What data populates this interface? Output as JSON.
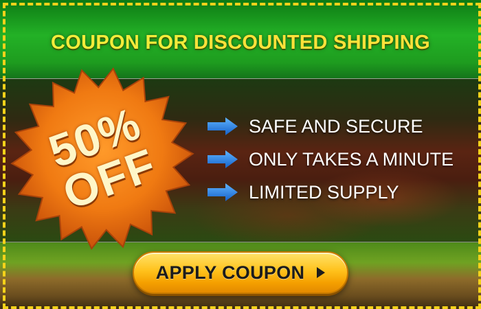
{
  "title": {
    "part1": "COUPON FOR ",
    "part2": "DISCOUNTED SHIPPING"
  },
  "badge": {
    "percent": "50%",
    "off": "OFF"
  },
  "features": [
    {
      "label": "SAFE AND SECURE",
      "icon": "arrow-right-icon"
    },
    {
      "label": "ONLY TAKES A MINUTE",
      "icon": "arrow-right-icon"
    },
    {
      "label": "LIMITED SUPPLY",
      "icon": "arrow-right-icon"
    }
  ],
  "button": {
    "label": "APPLY COUPON",
    "icon": "play-triangle-icon"
  },
  "colors": {
    "header_green": "#23b126",
    "title_yellow": "#f3ec3a",
    "border_yellow": "#f5d21a",
    "badge_orange": "#f07a12",
    "arrow_blue": "#1e7fe0",
    "button_orange": "#ffc21c"
  }
}
